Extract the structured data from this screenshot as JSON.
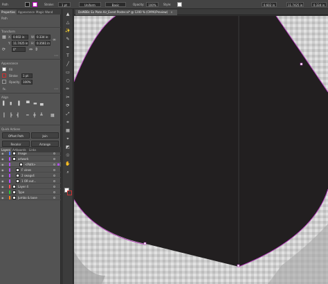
{
  "control_bar": {
    "selection_label": "Path",
    "stroke_label": "Stroke:",
    "stroke_weight": "1 pt",
    "profile_label": "Uniform",
    "brush_label": "Basic",
    "opacity_label": "Opacity:",
    "opacity_value": "100%",
    "style_label": "Style:",
    "x_value": "0.602 in",
    "y_value": "11.7425 in",
    "w_value": "0.334 in"
  },
  "panel_tabs": [
    "Properties",
    "Appearance",
    "Magic Wand"
  ],
  "properties": {
    "section_path": "Path",
    "section_transform": "Transform",
    "x": "0.602 in",
    "y": "11.7425 in",
    "w": "0.334 in",
    "h": "0.3561 in",
    "angle": "0°",
    "section_appearance": "Appearance",
    "fill_label": "Fill",
    "stroke_label": "Stroke",
    "stroke_weight": "1 pt",
    "opacity_label": "Opacity",
    "opacity_value": "100%",
    "fx_label": "fx.",
    "section_align": "Align",
    "section_quick_actions": "Quick Actions",
    "offset_path": "Offset Path",
    "join": "Join",
    "recolor": "Recolor",
    "arrange": "Arrange"
  },
  "layers_tabs": [
    "Layers",
    "Artboards",
    "Links"
  ],
  "layers": [
    {
      "name": "Image",
      "indent": 0,
      "color": "#4f7cff"
    },
    {
      "name": "artwork",
      "indent": 0,
      "color": "#b44cff"
    },
    {
      "name": "<Path>",
      "indent": 2,
      "color": "#b44cff"
    },
    {
      "name": "F vines",
      "indent": 1,
      "color": "#b44cff"
    },
    {
      "name": "2 swags4",
      "indent": 1,
      "color": "#b44cff"
    },
    {
      "name": "1 OR out...",
      "indent": 1,
      "color": "#b44cff"
    },
    {
      "name": "Layer 4",
      "indent": 0,
      "color": "#ff4d4d"
    },
    {
      "name": "Type",
      "indent": 0,
      "color": "#29c23a"
    },
    {
      "name": "Jumbo & base",
      "indent": 0,
      "color": "#ff7f1a"
    }
  ],
  "document": {
    "tab_title": "DxWBBc Ex Plate Air_Event Poster.ai* @ 1200 % (CMYK/Preview)",
    "close_glyph": "×"
  },
  "tools": [
    "▲",
    "△",
    "✨",
    "✎",
    "✒",
    "T",
    "╱",
    "▭",
    "○",
    "✏",
    "✂",
    "⟳",
    "⤢",
    "⌗",
    "▦",
    "⌖",
    "◩",
    "☉",
    "✋",
    "⌕"
  ],
  "colors": {
    "shape_fill": "#221f20",
    "path_stroke": "#b03ab6",
    "canvas_bg": "#d2d2d2",
    "panel_bg": "#535353"
  }
}
